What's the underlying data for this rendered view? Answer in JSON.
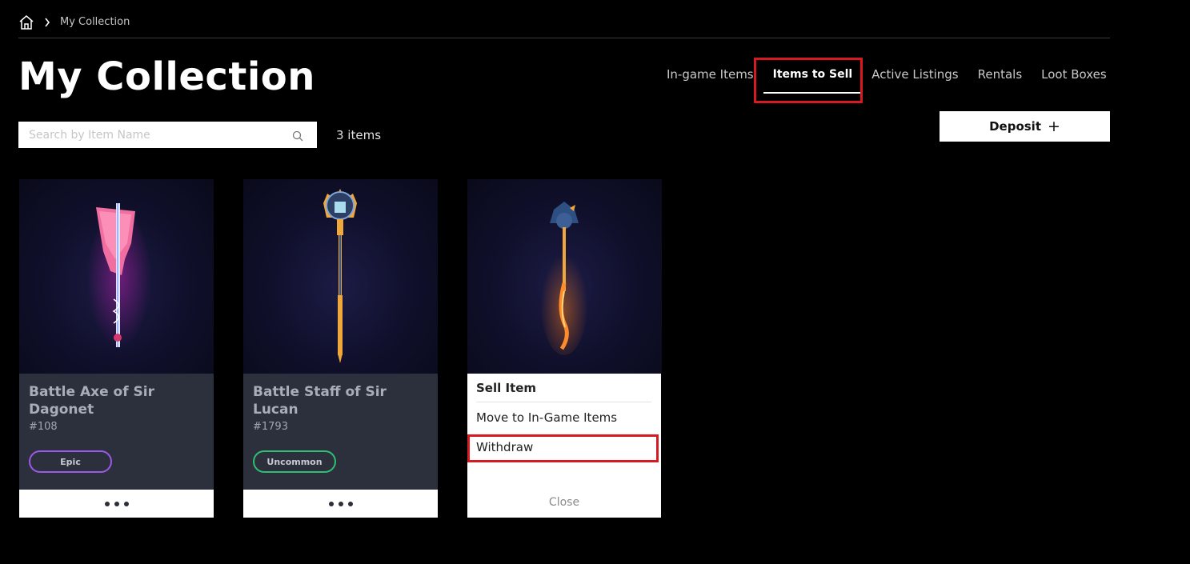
{
  "breadcrumb": {
    "home_icon": "home-icon",
    "separator_icon": "chevron-right-icon",
    "current": "My Collection"
  },
  "page": {
    "title": "My Collection"
  },
  "tabs": [
    {
      "label": "In-game Items",
      "active": false
    },
    {
      "label": "Items to Sell",
      "active": true
    },
    {
      "label": "Active Listings",
      "active": false
    },
    {
      "label": "Rentals",
      "active": false
    },
    {
      "label": "Loot Boxes",
      "active": false
    }
  ],
  "search": {
    "placeholder": "Search by Item Name",
    "icon": "search-icon"
  },
  "item_count": "3 items",
  "deposit": {
    "label": "Deposit",
    "icon": "plus-icon",
    "plus_glyph": "+"
  },
  "items": [
    {
      "name": "Battle Axe of Sir Dagonet",
      "number": "#108",
      "rarity": "Epic",
      "rarity_color": "#9b59e6"
    },
    {
      "name": "Battle Staff of Sir Lucan",
      "number": "#1793",
      "rarity": "Uncommon",
      "rarity_color": "#2fbf71"
    },
    {
      "name": "",
      "number": "",
      "rarity": ""
    }
  ],
  "context_menu": {
    "sell": "Sell Item",
    "move": "Move to In-Game Items",
    "withdraw": "Withdraw",
    "close": "Close"
  },
  "colors": {
    "highlight": "#d71921",
    "card_info_bg": "#2c303d",
    "background": "#000000"
  }
}
